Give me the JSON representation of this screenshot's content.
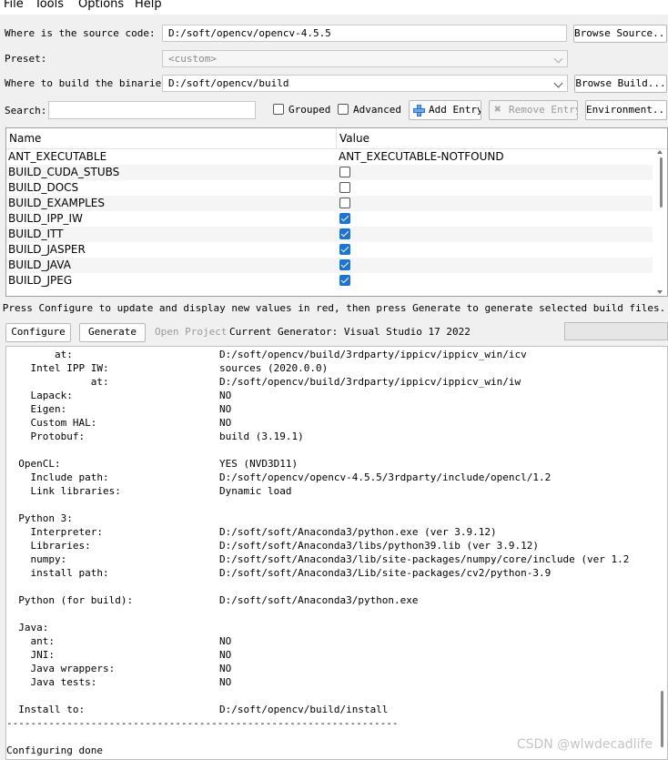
{
  "menu": [
    {
      "label": "File"
    },
    {
      "label": "Tools"
    },
    {
      "label": "Options"
    },
    {
      "label": "Help"
    }
  ],
  "source": {
    "label": "Where is the source code:",
    "value": "D:/soft/opencv/opencv-4.5.5",
    "browse": "Browse Source..."
  },
  "preset": {
    "label": "Preset:",
    "value": "<custom>"
  },
  "build": {
    "label": "Where to build the binaries:",
    "value": "D:/soft/opencv/build",
    "browse": "Browse Build..."
  },
  "search": {
    "label": "Search:",
    "value": ""
  },
  "options": {
    "grouped": "Grouped",
    "advanced": "Advanced",
    "add_entry": "Add Entry",
    "remove_entry": "Remove Entry",
    "environment": "Environment..."
  },
  "table": {
    "headers": {
      "name": "Name",
      "value": "Value"
    },
    "rows": [
      {
        "name": "ANT_EXECUTABLE",
        "value": "ANT_EXECUTABLE-NOTFOUND",
        "type": "text"
      },
      {
        "name": "BUILD_CUDA_STUBS",
        "checked": false,
        "type": "bool"
      },
      {
        "name": "BUILD_DOCS",
        "checked": false,
        "type": "bool"
      },
      {
        "name": "BUILD_EXAMPLES",
        "checked": false,
        "type": "bool"
      },
      {
        "name": "BUILD_IPP_IW",
        "checked": true,
        "type": "bool"
      },
      {
        "name": "BUILD_ITT",
        "checked": true,
        "type": "bool"
      },
      {
        "name": "BUILD_JASPER",
        "checked": true,
        "type": "bool"
      },
      {
        "name": "BUILD_JAVA",
        "checked": true,
        "type": "bool"
      },
      {
        "name": "BUILD_JPEG",
        "checked": true,
        "type": "bool"
      }
    ]
  },
  "hint": "Press Configure to update and display new values in red, then press Generate to generate selected build files.",
  "actions": {
    "configure": "Configure",
    "generate": "Generate",
    "open_project": "Open Project",
    "generator": "Current Generator: Visual Studio 17 2022"
  },
  "output": [
    {
      "k": "        at:",
      "v": "D:/soft/opencv/build/3rdparty/ippicv/ippicv_win/icv"
    },
    {
      "k": "    Intel IPP IW:",
      "v": "sources (2020.0.0)"
    },
    {
      "k": "              at:",
      "v": "D:/soft/opencv/build/3rdparty/ippicv/ippicv_win/iw"
    },
    {
      "k": "    Lapack:",
      "v": "NO"
    },
    {
      "k": "    Eigen:",
      "v": "NO"
    },
    {
      "k": "    Custom HAL:",
      "v": "NO"
    },
    {
      "k": "    Protobuf:",
      "v": "build (3.19.1)"
    },
    {
      "k": "",
      "v": ""
    },
    {
      "k": "  OpenCL:",
      "v": "YES (NVD3D11)"
    },
    {
      "k": "    Include path:",
      "v": "D:/soft/opencv/opencv-4.5.5/3rdparty/include/opencl/1.2"
    },
    {
      "k": "    Link libraries:",
      "v": "Dynamic load"
    },
    {
      "k": "",
      "v": ""
    },
    {
      "k": "  Python 3:",
      "v": ""
    },
    {
      "k": "    Interpreter:",
      "v": "D:/soft/soft/Anaconda3/python.exe (ver 3.9.12)"
    },
    {
      "k": "    Libraries:",
      "v": "D:/soft/soft/Anaconda3/libs/python39.lib (ver 3.9.12)"
    },
    {
      "k": "    numpy:",
      "v": "D:/soft/soft/Anaconda3/lib/site-packages/numpy/core/include (ver 1.2"
    },
    {
      "k": "    install path:",
      "v": "D:/soft/soft/Anaconda3/Lib/site-packages/cv2/python-3.9"
    },
    {
      "k": "",
      "v": ""
    },
    {
      "k": "  Python (for build):",
      "v": "D:/soft/soft/Anaconda3/python.exe"
    },
    {
      "k": "",
      "v": ""
    },
    {
      "k": "  Java:",
      "v": ""
    },
    {
      "k": "    ant:",
      "v": "NO"
    },
    {
      "k": "    JNI:",
      "v": "NO"
    },
    {
      "k": "    Java wrappers:",
      "v": "NO"
    },
    {
      "k": "    Java tests:",
      "v": "NO"
    },
    {
      "k": "",
      "v": ""
    },
    {
      "k": "  Install to:",
      "v": "D:/soft/opencv/build/install"
    },
    {
      "k": "-----------------------------------------------------------------",
      "v": ""
    },
    {
      "k": "",
      "v": ""
    },
    {
      "k": "Configuring done",
      "v": ""
    }
  ],
  "watermark": "CSDN @wlwdecadlife",
  "colors": {
    "accent": "#1a74d8",
    "add_icon": "#2a6fd6"
  }
}
